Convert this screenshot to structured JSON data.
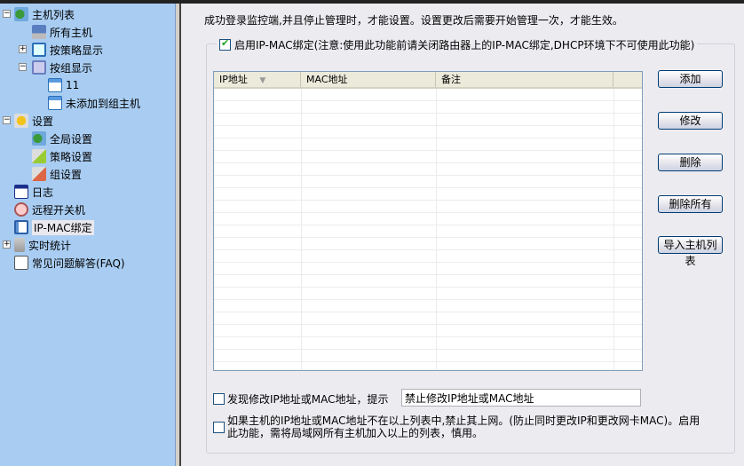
{
  "tree": [
    {
      "label": "主机列表",
      "icon": "host-list-icon",
      "expander": "-"
    },
    {
      "label": "所有主机",
      "icon": "computer-icon"
    },
    {
      "label": "按策略显示",
      "icon": "monitor-icon",
      "expander": "+"
    },
    {
      "label": "按组显示",
      "icon": "group-monitor-icon",
      "expander": "-"
    },
    {
      "label": "11",
      "icon": "table-icon"
    },
    {
      "label": "未添加到组主机",
      "icon": "table-icon"
    },
    {
      "label": "设置",
      "icon": "settings-icon",
      "expander": "-"
    },
    {
      "label": "全局设置",
      "icon": "global-settings-icon"
    },
    {
      "label": "策略设置",
      "icon": "policy-settings-icon"
    },
    {
      "label": "组设置",
      "icon": "group-settings-icon"
    },
    {
      "label": "日志",
      "icon": "log-icon"
    },
    {
      "label": "远程开关机",
      "icon": "remote-power-icon"
    },
    {
      "label": "IP-MAC绑定",
      "icon": "ip-mac-icon"
    },
    {
      "label": "实时统计",
      "icon": "stats-icon",
      "expander": "+"
    },
    {
      "label": "常见问题解答(FAQ)",
      "icon": "faq-icon"
    }
  ],
  "main": {
    "notice": "成功登录监控端,并且停止管理时，才能设置。设置更改后需要开始管理一次，才能生效。",
    "enable_label": "启用IP-MAC绑定(注意:使用此功能前请关闭路由器上的IP-MAC绑定,DHCP环境下不可使用此功能)",
    "enable_checked": true,
    "columns": [
      "IP地址",
      "MAC地址",
      "备注"
    ],
    "rows": [],
    "buttons": {
      "add": "添加",
      "edit": "修改",
      "delete": "删除",
      "delete_all": "删除所有",
      "import": "导入主机列表"
    },
    "opt1_label": "发现修改IP地址或MAC地址，提示",
    "opt1_checked": false,
    "hint_value": "禁止修改IP地址或MAC地址",
    "opt2_label": "如果主机的IP地址或MAC地址不在以上列表中,禁止其上网。(防止同时更改IP和更改网卡MAC)。启用此功能，需将局域网所有主机加入以上的列表，慎用。",
    "opt2_checked": false
  }
}
